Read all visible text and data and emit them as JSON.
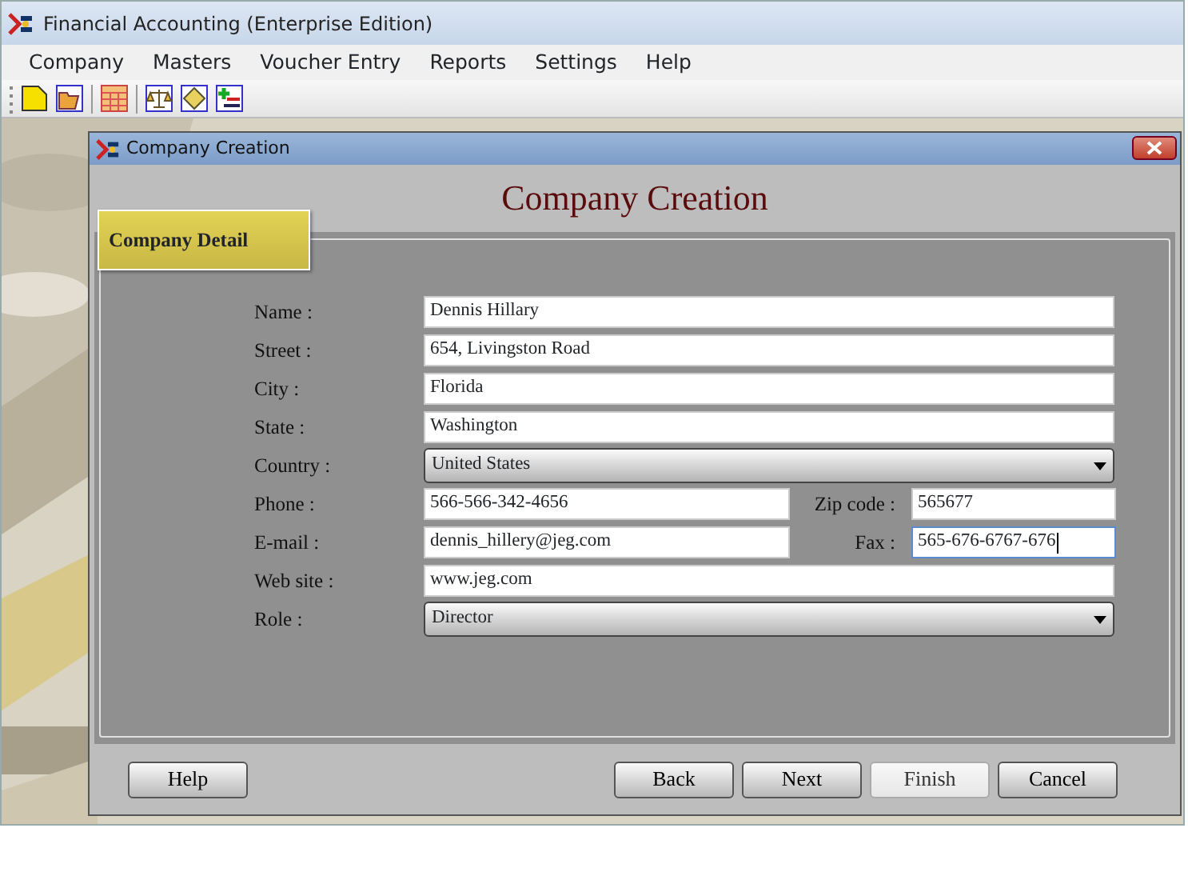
{
  "window": {
    "title": "Financial Accounting (Enterprise Edition)"
  },
  "menu": [
    "Company",
    "Masters",
    "Voucher Entry",
    "Reports",
    "Settings",
    "Help"
  ],
  "dialog": {
    "title": "Company Creation",
    "heading": "Company Creation",
    "group": "Company Detail",
    "rows": [
      {
        "fields": [
          {
            "kind": "text",
            "label": "Name :",
            "value": "Dennis Hillary",
            "focused": false
          }
        ]
      },
      {
        "fields": [
          {
            "kind": "text",
            "label": "Street :",
            "value": "654, Livingston Road",
            "focused": false
          }
        ]
      },
      {
        "fields": [
          {
            "kind": "text",
            "label": "City :",
            "value": "Florida",
            "focused": false
          }
        ]
      },
      {
        "fields": [
          {
            "kind": "text",
            "label": "State :",
            "value": "Washington",
            "focused": false
          }
        ]
      },
      {
        "fields": [
          {
            "kind": "select",
            "label": "Country :",
            "value": "United States"
          }
        ]
      },
      {
        "fields": [
          {
            "kind": "text",
            "label": "Phone :",
            "value": "566-566-342-4656",
            "focused": false
          },
          {
            "kind": "text",
            "label": "Zip code :",
            "value": "565677",
            "focused": false
          }
        ]
      },
      {
        "fields": [
          {
            "kind": "text",
            "label": "E-mail :",
            "value": "dennis_hillery@jeg.com",
            "focused": false
          },
          {
            "kind": "text",
            "label": "Fax :",
            "value": "565-676-6767-676",
            "focused": true
          }
        ]
      },
      {
        "fields": [
          {
            "kind": "text",
            "label": "Web site :",
            "value": "www.jeg.com",
            "focused": false
          }
        ]
      },
      {
        "fields": [
          {
            "kind": "select",
            "label": "Role :",
            "value": "Director"
          }
        ]
      }
    ],
    "left_buttons": [
      {
        "label": "Help",
        "disabled": false
      }
    ],
    "right_buttons": [
      {
        "label": "Back",
        "disabled": false
      },
      {
        "label": "Next",
        "disabled": false
      },
      {
        "label": "Finish",
        "disabled": true
      },
      {
        "label": "Cancel",
        "disabled": false
      }
    ]
  }
}
